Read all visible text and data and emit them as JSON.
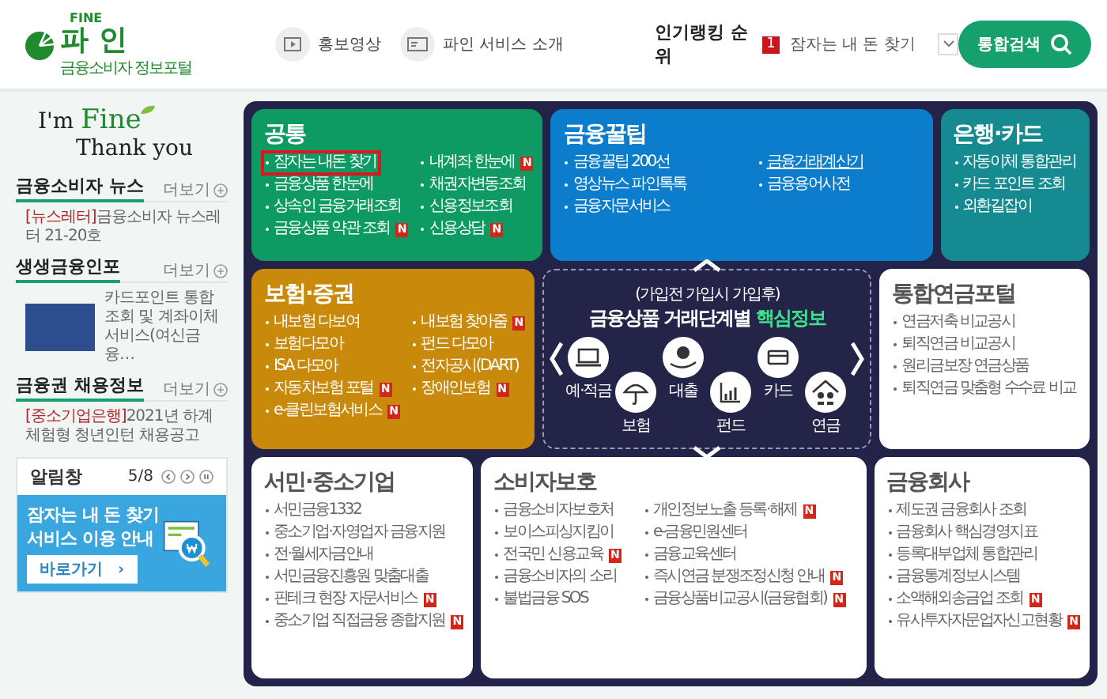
{
  "logo": {
    "brand": "FINE",
    "name": "파 인",
    "tagline": "금융소비자 정보포털"
  },
  "nav": [
    {
      "label": "홍보영상"
    },
    {
      "label": "파인 서비스 소개"
    }
  ],
  "ranking": {
    "label": "인기랭킹 순위",
    "rank": "1",
    "item": "잠자는 내 돈 찾기"
  },
  "search_button": "통합검색",
  "greeting": {
    "line1_start": "I'm",
    "line1_accent": "Fine",
    "line2": "Thank you"
  },
  "sections": [
    {
      "kind": "news",
      "title": "금융소비자 뉴스",
      "more": "더보기",
      "tag": "[뉴스레터]",
      "text": "금융소비자 뉴스레터 21-20호"
    },
    {
      "kind": "thumb",
      "title": "생생금융인포",
      "more": "더보기",
      "text": "카드포인트 통합조회 및 계좌이체 서비스(여신금융…"
    },
    {
      "kind": "news",
      "title": "금융권 채용정보",
      "more": "더보기",
      "tag": "[중소기업은행]",
      "text": "2021년 하계 체험형 청년인턴 채용공고"
    }
  ],
  "notice": {
    "title": "알림창",
    "counter": "5/8",
    "banner_line1": "잠자는 내 돈 찾기",
    "banner_line2": "서비스 이용 안내",
    "button": "바로가기",
    "button_arrow": "›"
  },
  "tiles": [
    {
      "kind": "menu",
      "title": "공통",
      "color": "#0e9b63",
      "two_columns": true,
      "items": [
        {
          "label": "잠자는 내돈 찾기",
          "highlighted": true
        },
        {
          "label": "내계좌 한눈에",
          "badge": "N",
          "highlighted": false
        },
        {
          "label": "금융상품 한눈에",
          "highlighted": false
        },
        {
          "label": "채권자변동조회",
          "highlighted": false
        },
        {
          "label": "상속인 금융거래조회",
          "highlighted": false
        },
        {
          "label": "신용정보조회",
          "highlighted": false
        },
        {
          "label": "금융상품 약관 조회",
          "badge": "N",
          "highlighted": false
        },
        {
          "label": "신용상담",
          "badge": "N",
          "highlighted": false
        }
      ]
    },
    {
      "kind": "menu",
      "title": "금융꿀팁",
      "color": "#0b7dcc",
      "two_columns": true,
      "items": [
        {
          "label": "금융꿀팁 200선",
          "underlined": false
        },
        {
          "label": "금융거래계산기",
          "underlined": true
        },
        {
          "label": "영상뉴스 파인톡톡",
          "underlined": false
        },
        {
          "label": "금융용어사전",
          "underlined": false
        },
        {
          "label": "금융자문서비스",
          "underlined": false
        }
      ]
    },
    {
      "kind": "menu",
      "title": "은행·카드",
      "color": "#158a90",
      "two_columns": false,
      "items": [
        {
          "label": "자동이체 통합관리"
        },
        {
          "label": "카드 포인트 조회"
        },
        {
          "label": "외환길잡이"
        }
      ]
    },
    {
      "kind": "menu",
      "title": "보험·증권",
      "color": "#c98a0c",
      "two_columns": true,
      "items": [
        {
          "label": "내보험 다보여"
        },
        {
          "label": "내보험 찾아줌",
          "badge": "N"
        },
        {
          "label": "보험다모아"
        },
        {
          "label": "펀드 다모아"
        },
        {
          "label": "ISA 다모아"
        },
        {
          "label": "전자공시(DART)"
        },
        {
          "label": "자동차보험 포털",
          "badge": "N"
        },
        {
          "label": "장애인보험",
          "badge": "N"
        },
        {
          "label": "e-클린보험서비스",
          "badge": "N"
        }
      ]
    },
    {
      "kind": "core",
      "color": "#242449",
      "subtitle": "(가입전 가입시 가입후)",
      "title": "금융상품 거래단계별",
      "highlight": "핵심정보",
      "items": [
        {
          "label": "예·적금"
        },
        {
          "label": "보험"
        },
        {
          "label": "대출"
        },
        {
          "label": "펀드"
        },
        {
          "label": "카드"
        },
        {
          "label": "연금"
        }
      ]
    },
    {
      "kind": "menu",
      "title": "통합연금포털",
      "color": "#ffffff",
      "two_columns": false,
      "items": [
        {
          "label": "연금저축 비교공시"
        },
        {
          "label": "퇴직연금 비교공시"
        },
        {
          "label": "원리금보장 연금상품"
        },
        {
          "label": "퇴직연금 맞춤형 수수료 비교"
        }
      ]
    },
    {
      "kind": "menu",
      "title": "서민·중소기업",
      "color": "#ffffff",
      "two_columns": false,
      "items": [
        {
          "label": "서민금융1332"
        },
        {
          "label": "중소기업·자영업자 금융지원"
        },
        {
          "label": "전·월세자금안내"
        },
        {
          "label": "서민금융진흥원 맞춤대출"
        },
        {
          "label": "핀테크 현장 자문서비스",
          "badge": "N"
        },
        {
          "label": "중소기업 직접금융 종합지원",
          "badge": "N"
        }
      ]
    },
    {
      "kind": "menu",
      "title": "소비자보호",
      "color": "#ffffff",
      "two_columns": true,
      "items": [
        {
          "label": "금융소비자보호처"
        },
        {
          "label": "개인정보노출 등록·해제",
          "badge": "N"
        },
        {
          "label": "보이스피싱지킴이"
        },
        {
          "label": "e-금융민원센터"
        },
        {
          "label": "전국민 신용교육",
          "badge": "N"
        },
        {
          "label": "금융교육센터"
        },
        {
          "label": "금융소비자의 소리"
        },
        {
          "label": "즉시연금 분쟁조정신청 안내",
          "badge": "N"
        },
        {
          "label": "불법금융 SOS"
        },
        {
          "label": "금융상품비교공시(금융협회)",
          "badge": "N"
        }
      ]
    },
    {
      "kind": "menu",
      "title": "금융회사",
      "color": "#ffffff",
      "two_columns": false,
      "items": [
        {
          "label": "제도권 금융회사 조회"
        },
        {
          "label": "금융회사 핵심경영지표"
        },
        {
          "label": "등록대부업체 통합관리"
        },
        {
          "label": "금융통계정보시스템"
        },
        {
          "label": "소액해외송금업 조회",
          "badge": "N"
        },
        {
          "label": "유사투자자문업자신고현황",
          "badge": "N"
        }
      ]
    }
  ]
}
